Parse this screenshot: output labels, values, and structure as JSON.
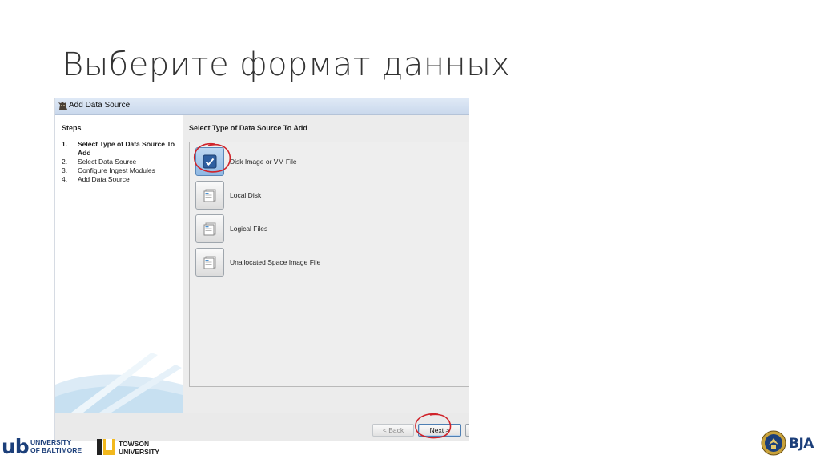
{
  "slide": {
    "title": "Выберите формат данных"
  },
  "window": {
    "title": "Add Data Source"
  },
  "steps": {
    "header": "Steps",
    "items": [
      {
        "num": "1.",
        "label": "Select Type of Data Source To Add"
      },
      {
        "num": "2.",
        "label": "Select Data Source"
      },
      {
        "num": "3.",
        "label": "Configure Ingest Modules"
      },
      {
        "num": "4.",
        "label": "Add Data Source"
      }
    ]
  },
  "panel": {
    "header": "Select Type of Data Source To Add",
    "options": [
      {
        "label": "Disk Image or VM File",
        "icon": "checkmark-icon",
        "selected": true
      },
      {
        "label": "Local Disk",
        "icon": "disk-icon",
        "selected": false
      },
      {
        "label": "Logical Files",
        "icon": "files-icon",
        "selected": false
      },
      {
        "label": "Unallocated Space Image File",
        "icon": "files-icon",
        "selected": false
      }
    ]
  },
  "buttons": {
    "back": "< Back",
    "next": "Next >"
  },
  "footer": {
    "ub_mark": "ub",
    "ub_line1": "UNIVERSITY",
    "ub_line2": "OF BALTIMORE",
    "tu_line1": "TOWSON",
    "tu_line2": "UNIVERSITY",
    "bja": "BJA"
  },
  "colors": {
    "annotation_red": "#d0232a",
    "accent_blue": "#1c3f7a"
  }
}
